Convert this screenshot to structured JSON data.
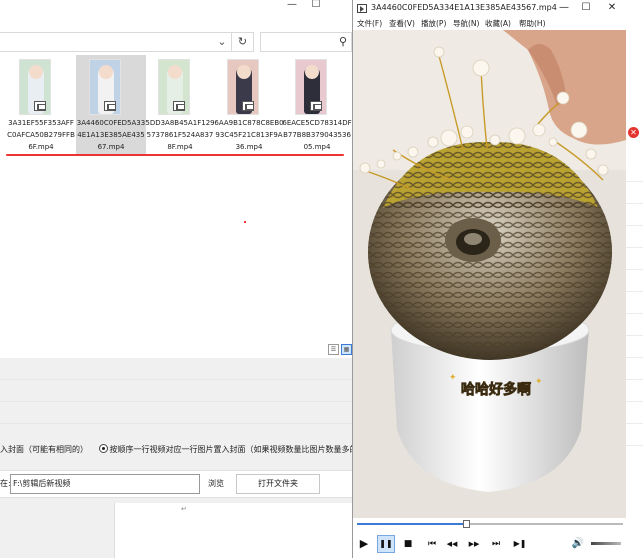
{
  "explorer": {
    "window_buttons": [
      "—",
      "☐"
    ],
    "search_placeholder": "",
    "files": [
      {
        "name": "3A31EF55F353AFFC0AFCA50B279FFB6F.mp4",
        "selected": false,
        "bg": "#cfe3d2",
        "outfit": "#e9eef3"
      },
      {
        "name": "3A4460C0FED5A334E1A13E385AE43567.mp4",
        "selected": true,
        "bg": "#bfd2e6",
        "outfit": "#f2f2f2"
      },
      {
        "name": "5DD3A8B45A1F1295737861F524A8378F.mp4",
        "selected": false,
        "bg": "#d4e5cf",
        "outfit": "#e6efe6"
      },
      {
        "name": "6AA9B1C878C8EB093C45F21C813F9A36.mp4",
        "selected": false,
        "bg": "#e6c8c0",
        "outfit": "#3a3a4a"
      },
      {
        "name": "6EACE5CD78314DFB77B8B37904353605.mp4",
        "selected": false,
        "bg": "#e8c9cf",
        "outfit": "#2e2e3a"
      }
    ]
  },
  "app": {
    "option_partial": "入封面（可能有相同的）",
    "option_selected": "按顺序一行视频对应一行图片置入封面（如果视频数量比图片数量多的话，多出",
    "save_label": "在:",
    "path_value": "F:\\剪辑后新视频",
    "browse_label": "浏览",
    "open_folder_label": "打开文件夹"
  },
  "player": {
    "title": "3A4460C0FED5A334E1A13E385AE43567.mp4",
    "window_buttons": [
      "—",
      "☐",
      "✕"
    ],
    "menu": [
      "文件(F)",
      "查看(V)",
      "播放(P)",
      "导航(N)",
      "收藏(A)",
      "帮助(H)"
    ],
    "video_caption": "哈哈好多啊",
    "progress": 0.41,
    "controls": {
      "play": "▶",
      "pause": "❚❚",
      "stop": "■",
      "prev": "⏮",
      "rewind": "◀◀",
      "forward": "▶▶",
      "next": "⏭",
      "frame_step": "▶❚",
      "volume": "🔊"
    }
  }
}
